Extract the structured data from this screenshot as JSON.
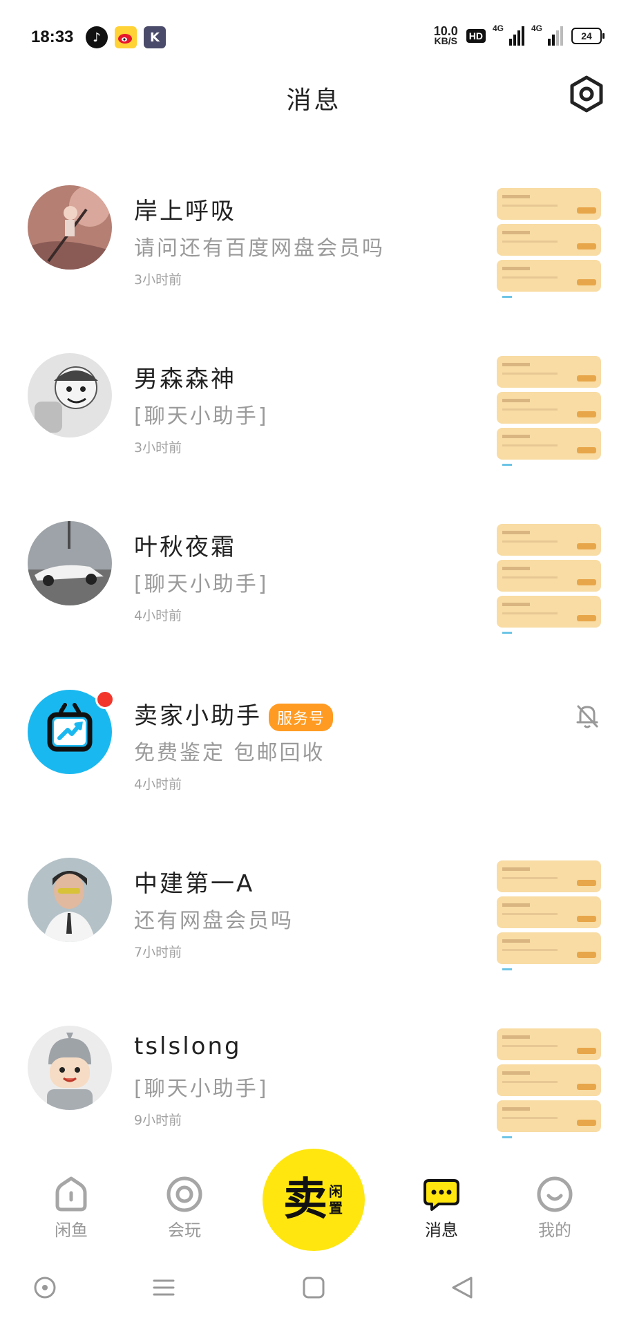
{
  "status_bar": {
    "time": "18:33",
    "speed_value": "10.0",
    "speed_unit": "KB/S",
    "hd_label": "HD",
    "signal_1": "4G",
    "signal_2": "4G",
    "battery": "24",
    "app_icons": [
      "tiktok-icon",
      "weibo-icon",
      "k-app-icon"
    ]
  },
  "header": {
    "title": "消息",
    "settings_icon": "settings-icon"
  },
  "conversations": [
    {
      "name": "岸上呼吸",
      "preview": "请问还有百度网盘会员吗",
      "time": "3小时前",
      "has_thumbnail": true
    },
    {
      "name": "男森森神",
      "preview": "[聊天小助手]",
      "time": "3小时前",
      "has_thumbnail": true
    },
    {
      "name": "叶秋夜霜",
      "preview": "[聊天小助手]",
      "time": "4小时前",
      "has_thumbnail": true
    },
    {
      "name": "卖家小助手",
      "tag": "服务号",
      "preview": "免费鉴定 包邮回收",
      "time": "4小时前",
      "has_unread_dot": true,
      "muted": true
    },
    {
      "name": "中建第一A",
      "preview": "还有网盘会员吗",
      "time": "7小时前",
      "has_thumbnail": true
    },
    {
      "name": "tslslong",
      "preview": "[聊天小助手]",
      "time": "9小时前",
      "has_thumbnail": true
    }
  ],
  "tabbar": {
    "items": [
      {
        "label": "闲鱼",
        "icon": "home-icon",
        "active": false
      },
      {
        "label": "会玩",
        "icon": "play-circle-icon",
        "active": false
      },
      {
        "label": "消息",
        "icon": "message-bubble-icon",
        "active": true
      },
      {
        "label": "我的",
        "icon": "smile-face-icon",
        "active": false
      }
    ],
    "sell_button": {
      "big": "卖",
      "small": "闲置"
    }
  },
  "colors": {
    "accent_yellow": "#ffe60f",
    "tag_orange": "#ff9b22",
    "unread_red": "#f2362c",
    "avatar_blue": "#1ab8f0"
  }
}
